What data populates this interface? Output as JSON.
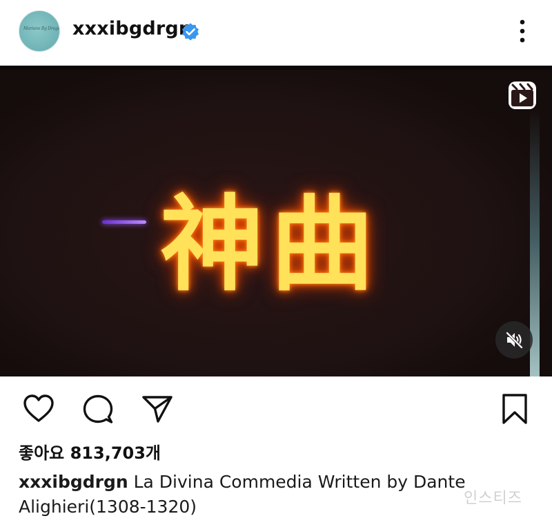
{
  "post": {
    "username": "xxxibgdrgn",
    "avatar_text": "Mariano Bg Dragon"
  },
  "media": {
    "overlay_text": "神曲",
    "type_icon": "reels-icon",
    "audio_icon": "speaker-muted-icon"
  },
  "actions": {
    "like_icon": "heart-outline-icon",
    "comment_icon": "comment-bubble-icon",
    "share_icon": "paper-plane-icon",
    "save_icon": "bookmark-outline-icon"
  },
  "likes": {
    "label": "좋아요",
    "count": "813,703개"
  },
  "caption": {
    "username": "xxxibgdrgn",
    "text": " La Divina Commedia Written by Dante Alighieri(1308-1320)"
  },
  "watermark": {
    "text": "인스티즈"
  }
}
